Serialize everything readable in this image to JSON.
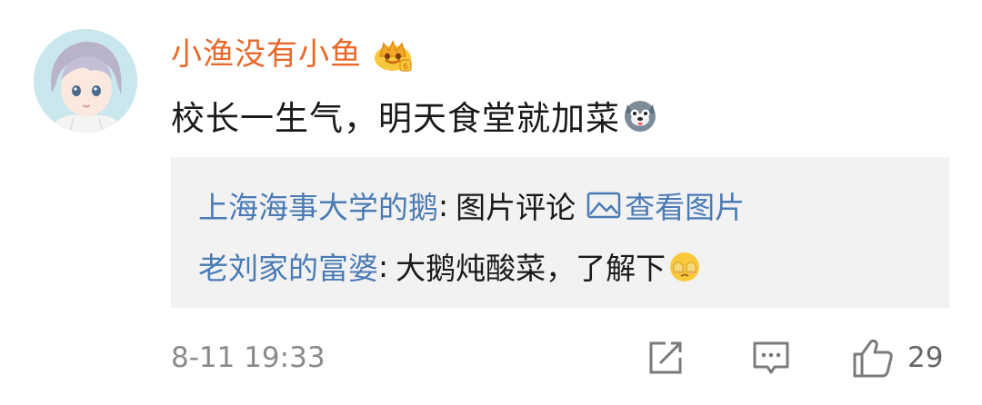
{
  "comment": {
    "username": "小渔没有小鱼",
    "text": "校长一生气，明天食堂就加菜",
    "timestamp": "8-11 19:33",
    "like_count": "29",
    "icons": {
      "avatar": "avatar",
      "vip": "vip-crown-icon",
      "emoji_main": "husky-dog-emoji-icon",
      "share": "share-icon",
      "reply": "comment-icon",
      "like": "thumbs-up-icon"
    }
  },
  "replies": [
    {
      "author": "上海海事大学的鹅",
      "separator": ":",
      "text": "图片评论",
      "link_text": "查看图片",
      "icon": "image-icon"
    },
    {
      "author": "老刘家的富婆",
      "separator": ":",
      "text": "大鹅炖酸菜，了解下",
      "icon": "face-emoji-icon"
    }
  ],
  "colors": {
    "username": "#e8692a",
    "reply_author": "#4a7bb5",
    "text": "#1a1a1a",
    "meta": "#8a8a8a",
    "reply_bg": "#f2f2f2"
  }
}
